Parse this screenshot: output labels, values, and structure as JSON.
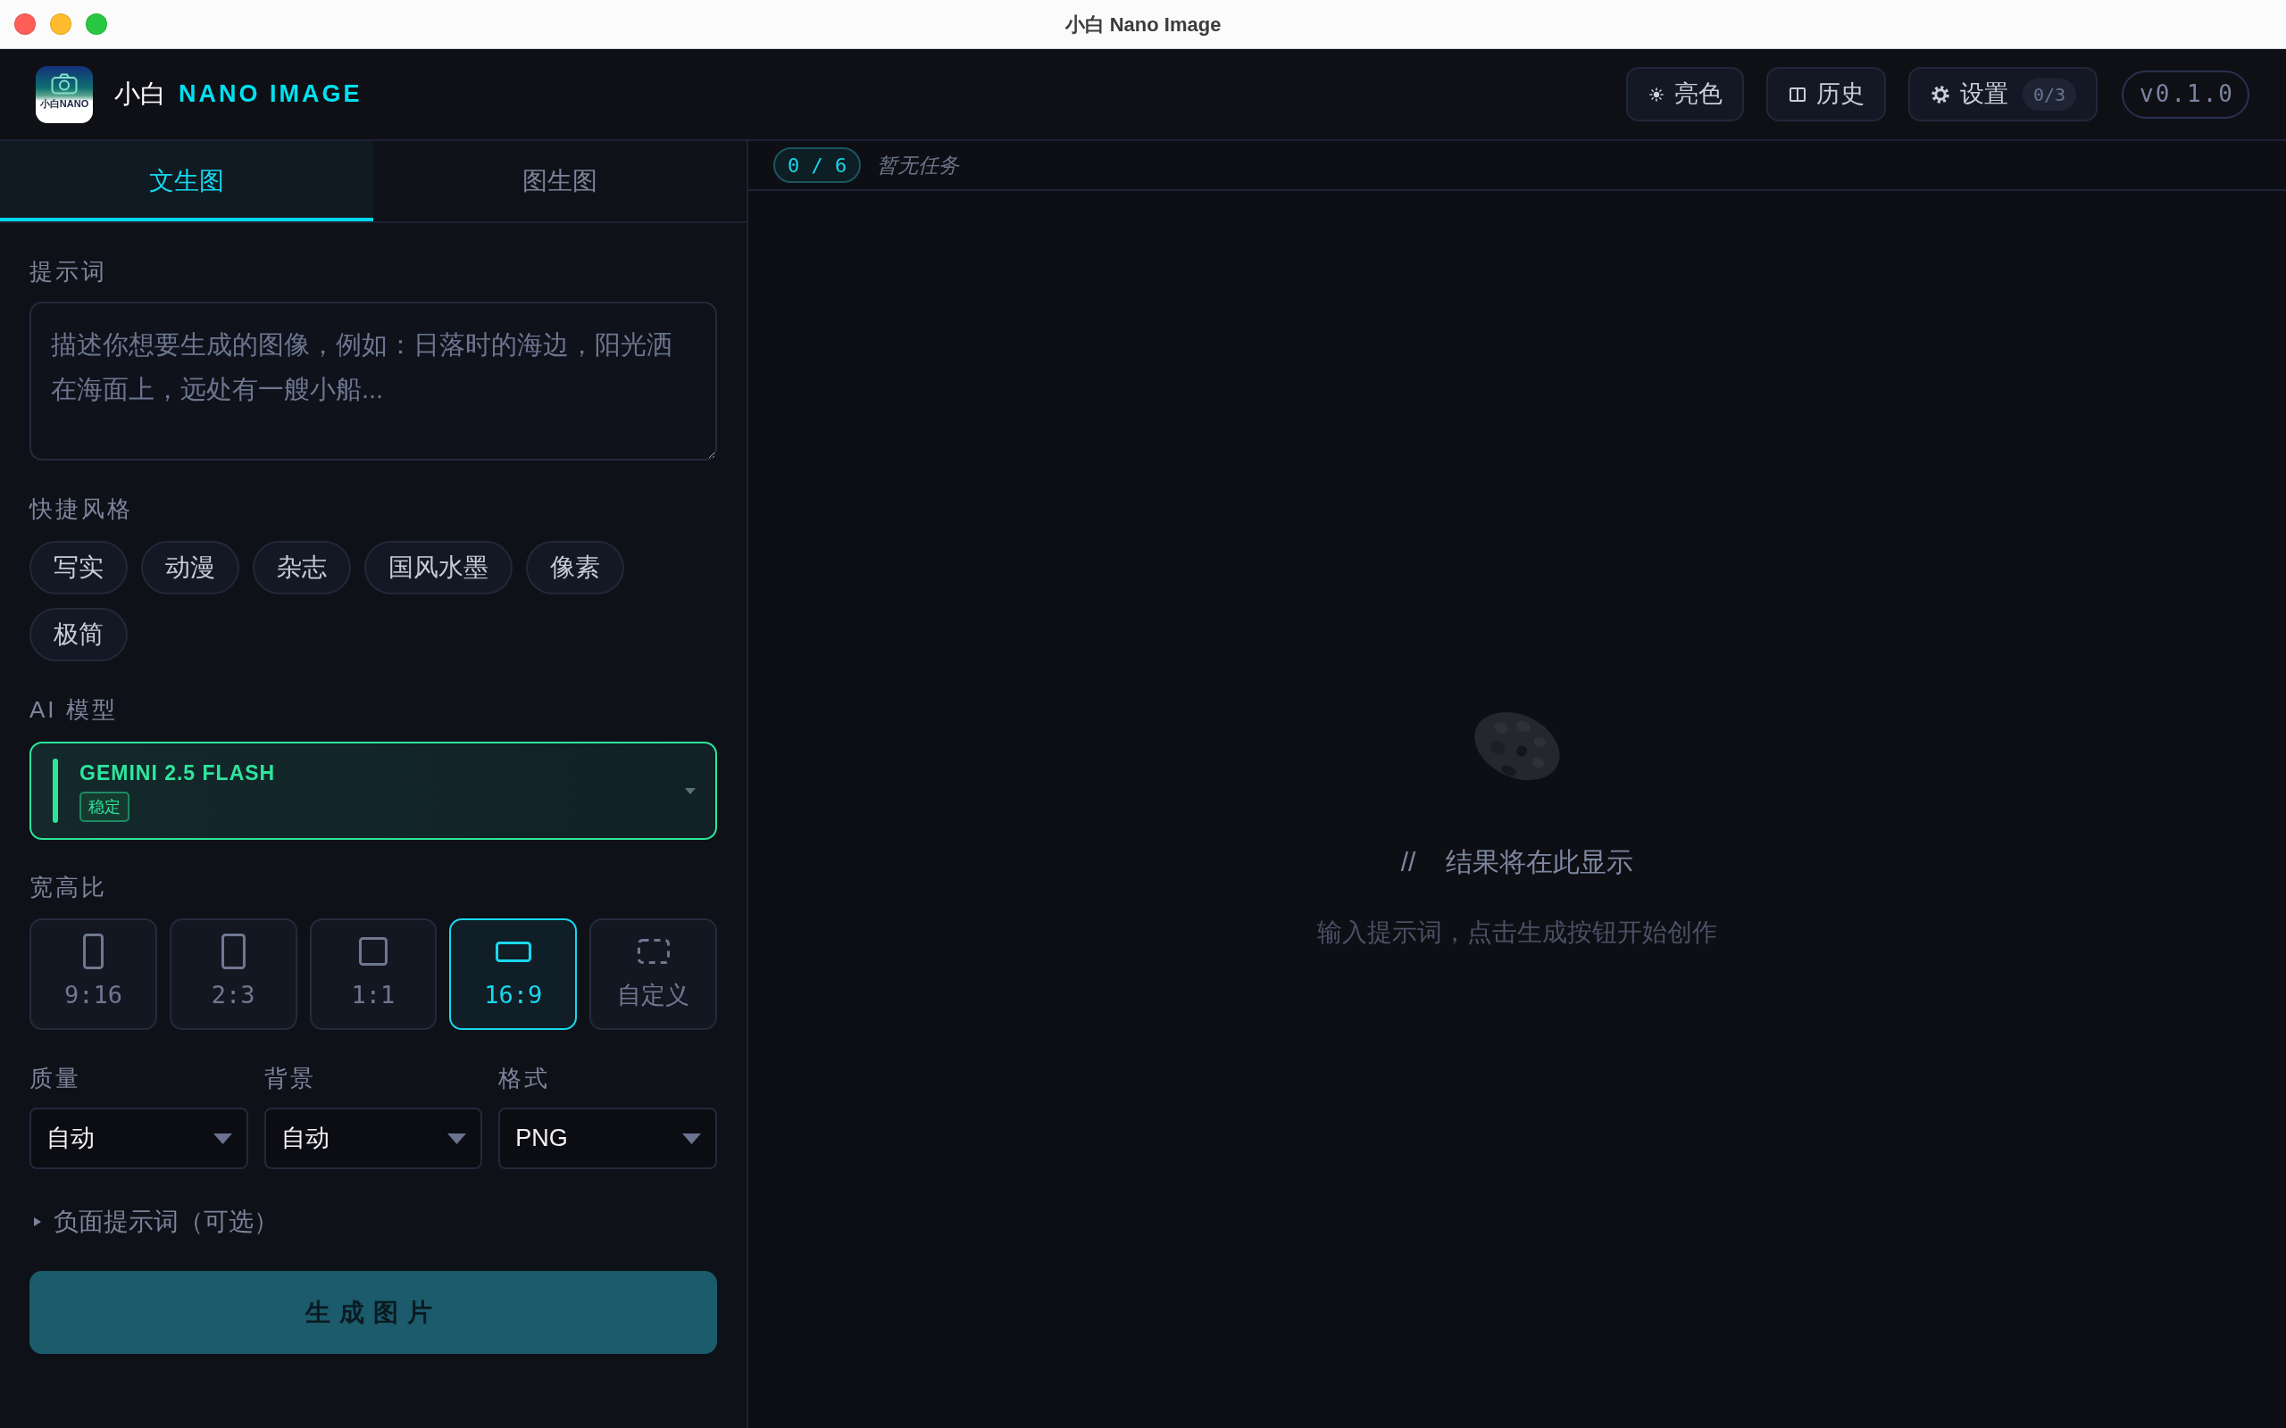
{
  "window": {
    "title": "小白 Nano Image"
  },
  "header": {
    "logo_text": "小白NANO",
    "brand": "小白",
    "product": "NANO IMAGE",
    "buttons": [
      {
        "kind": "theme",
        "label": "亮色"
      },
      {
        "kind": "history",
        "label": "历史"
      },
      {
        "kind": "settings",
        "label": "设置",
        "badge": "0/3"
      }
    ],
    "version": "v0.1.0"
  },
  "tabs": [
    {
      "label": "文生图",
      "selected": true
    },
    {
      "label": "图生图",
      "selected": false
    }
  ],
  "prompt": {
    "label": "提示词",
    "placeholder": "描述你想要生成的图像，例如：日落时的海边，阳光洒在海面上，远处有一艘小船..."
  },
  "styles": {
    "label": "快捷风格",
    "chips": [
      "写实",
      "动漫",
      "杂志",
      "国风水墨",
      "像素",
      "极简"
    ]
  },
  "model": {
    "label": "AI 模型",
    "name": "GEMINI 2.5 FLASH",
    "tag": "稳定"
  },
  "aspect": {
    "label": "宽高比",
    "options": [
      {
        "kind": "tall",
        "label": "9:16",
        "selected": false
      },
      {
        "kind": "portrait",
        "label": "2:3",
        "selected": false
      },
      {
        "kind": "square",
        "label": "1:1",
        "selected": false
      },
      {
        "kind": "wide",
        "label": "16:9",
        "selected": true
      },
      {
        "kind": "custom",
        "label": "自定义",
        "selected": false
      }
    ]
  },
  "output": [
    {
      "label": "质量",
      "value": "自动"
    },
    {
      "label": "背景",
      "value": "自动"
    },
    {
      "label": "格式",
      "value": "PNG"
    }
  ],
  "negative_prompt": {
    "label": "负面提示词（可选）",
    "expanded": false
  },
  "generate_button": "生成图片",
  "queue": {
    "count": "0 / 6",
    "status": "暂无任务"
  },
  "result": {
    "prefix": "//",
    "title": "结果将在此显示",
    "hint": "输入提示词，点击生成按钮开始创作"
  }
}
